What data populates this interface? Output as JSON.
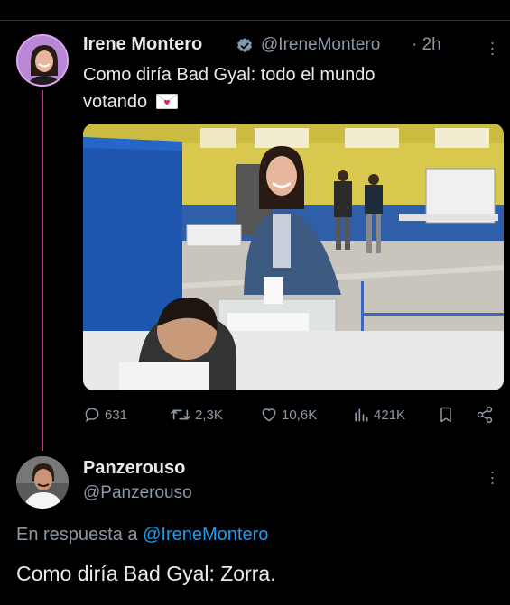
{
  "tweet": {
    "author_name": "Irene Montero",
    "author_handle": "@IreneMontero",
    "time": "· 2h",
    "text_line1": "Como diría Bad Gyal: todo el mundo",
    "text_line2": "votando",
    "envelope_icon": "love-letter-emoji",
    "stats": {
      "replies": "631",
      "retweets": "2,3K",
      "likes": "10,6K",
      "views": "421K"
    }
  },
  "reply": {
    "author_name": "Panzerouso",
    "author_handle": "@Panzerouso",
    "reply_to_prefix": "En respuesta a",
    "reply_to_mention": "@IreneMontero",
    "text": "Como diría Bad Gyal: Zorra."
  },
  "colors": {
    "background": "#000000",
    "text": "#e7e9ea",
    "muted": "#8b98a5",
    "link": "#1d9bf0",
    "verified": "#829aab",
    "thread_line": "#c9468f"
  }
}
